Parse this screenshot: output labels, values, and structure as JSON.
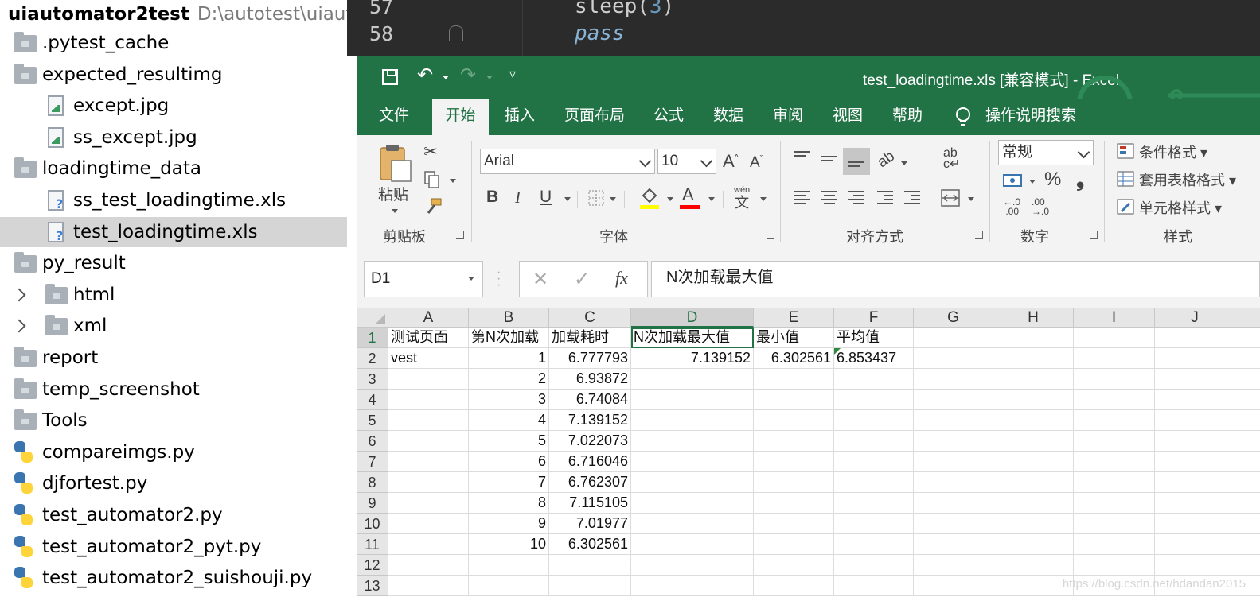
{
  "project_tree": {
    "project_name": "uiautomator2test",
    "project_path": "D:\\autotest\\uiaut",
    "items": [
      {
        "label": ".pytest_cache",
        "icon": "folder-icon"
      },
      {
        "label": "expected_resultimg",
        "icon": "folder-icon"
      },
      {
        "label": "except.jpg",
        "icon": "image-file-icon"
      },
      {
        "label": "ss_except.jpg",
        "icon": "image-file-icon"
      },
      {
        "label": "loadingtime_data",
        "icon": "folder-icon"
      },
      {
        "label": "ss_test_loadingtime.xls",
        "icon": "unknown-file-icon"
      },
      {
        "label": "test_loadingtime.xls",
        "icon": "unknown-file-icon",
        "selected": true
      },
      {
        "label": "py_result",
        "icon": "folder-icon"
      },
      {
        "label": "html",
        "icon": "folder-icon",
        "collapsed": true
      },
      {
        "label": "xml",
        "icon": "folder-icon",
        "collapsed": true
      },
      {
        "label": "report",
        "icon": "folder-icon"
      },
      {
        "label": "temp_screenshot",
        "icon": "folder-icon"
      },
      {
        "label": "Tools",
        "icon": "folder-icon"
      },
      {
        "label": "compareimgs.py",
        "icon": "python-file-icon"
      },
      {
        "label": "djfortest.py",
        "icon": "python-file-icon"
      },
      {
        "label": "test_automator2.py",
        "icon": "python-file-icon"
      },
      {
        "label": "test_automator2_pyt.py",
        "icon": "python-file-icon"
      },
      {
        "label": "test_automator2_suishouji.py",
        "icon": "python-file-icon"
      }
    ]
  },
  "editor": {
    "lines": [
      {
        "number": "57",
        "code_pre": "sleep(",
        "code_num": "3",
        "code_post": ")"
      },
      {
        "number": "58",
        "keyword": "pass"
      }
    ]
  },
  "excel": {
    "title": "test_loadingtime.xls  [兼容模式]  -  Excel",
    "tabs": [
      "文件",
      "开始",
      "插入",
      "页面布局",
      "公式",
      "数据",
      "审阅",
      "视图",
      "帮助"
    ],
    "active_tab": "开始",
    "search_label": "操作说明搜索",
    "ribbon": {
      "paste_label": "粘贴",
      "clipboard_label": "剪贴板",
      "font_name": "Arial",
      "font_size": "10",
      "font_label": "字体",
      "bold": "B",
      "italic": "I",
      "underline": "U",
      "phonetic": "wén",
      "align_label": "对齐方式",
      "number_format": "常规",
      "percent": "%",
      "comma": "❟",
      "dec_inc": ".00",
      "dec_dec": ".0",
      "number_label": "数字",
      "cond_format": "条件格式",
      "table_format": "套用表格格式",
      "cell_style": "单元格样式",
      "styles_label": "样式",
      "wrap_label": "ab"
    },
    "name_box": "D1",
    "fx": "fx",
    "formula": "N次加载最大值",
    "columns": [
      "A",
      "B",
      "C",
      "D",
      "E",
      "F",
      "G",
      "H",
      "I",
      "J"
    ],
    "selected_column": "D",
    "rows": [
      {
        "n": "1",
        "cells": [
          "测试页面",
          "第N次加载",
          "加载耗时",
          "N次加载最大值",
          "最小值",
          "平均值",
          "",
          "",
          "",
          ""
        ]
      },
      {
        "n": "2",
        "cells": [
          "vest",
          "1",
          "6.777793",
          "7.139152",
          "6.302561",
          "6.853437",
          "",
          "",
          "",
          ""
        ]
      },
      {
        "n": "3",
        "cells": [
          "",
          "2",
          "6.93872",
          "",
          "",
          "",
          "",
          "",
          "",
          ""
        ]
      },
      {
        "n": "4",
        "cells": [
          "",
          "3",
          "6.74084",
          "",
          "",
          "",
          "",
          "",
          "",
          ""
        ]
      },
      {
        "n": "5",
        "cells": [
          "",
          "4",
          "7.139152",
          "",
          "",
          "",
          "",
          "",
          "",
          ""
        ]
      },
      {
        "n": "6",
        "cells": [
          "",
          "5",
          "7.022073",
          "",
          "",
          "",
          "",
          "",
          "",
          ""
        ]
      },
      {
        "n": "7",
        "cells": [
          "",
          "6",
          "6.716046",
          "",
          "",
          "",
          "",
          "",
          "",
          ""
        ]
      },
      {
        "n": "8",
        "cells": [
          "",
          "7",
          "6.762307",
          "",
          "",
          "",
          "",
          "",
          "",
          ""
        ]
      },
      {
        "n": "9",
        "cells": [
          "",
          "8",
          "7.115105",
          "",
          "",
          "",
          "",
          "",
          "",
          ""
        ]
      },
      {
        "n": "10",
        "cells": [
          "",
          "9",
          "7.01977",
          "",
          "",
          "",
          "",
          "",
          "",
          ""
        ]
      },
      {
        "n": "11",
        "cells": [
          "",
          "10",
          "6.302561",
          "",
          "",
          "",
          "",
          "",
          "",
          ""
        ]
      },
      {
        "n": "12",
        "cells": [
          "",
          "",
          "",
          "",
          "",
          "",
          "",
          "",
          "",
          ""
        ]
      },
      {
        "n": "13",
        "cells": [
          "",
          "",
          "",
          "",
          "",
          "",
          "",
          "",
          "",
          ""
        ]
      }
    ],
    "watermark": "https://blog.csdn.net/hdandan2015"
  },
  "colors": {
    "excel_green": "#217346",
    "editor_bg": "#2b2b2b",
    "selection": "#d5d5d5"
  }
}
